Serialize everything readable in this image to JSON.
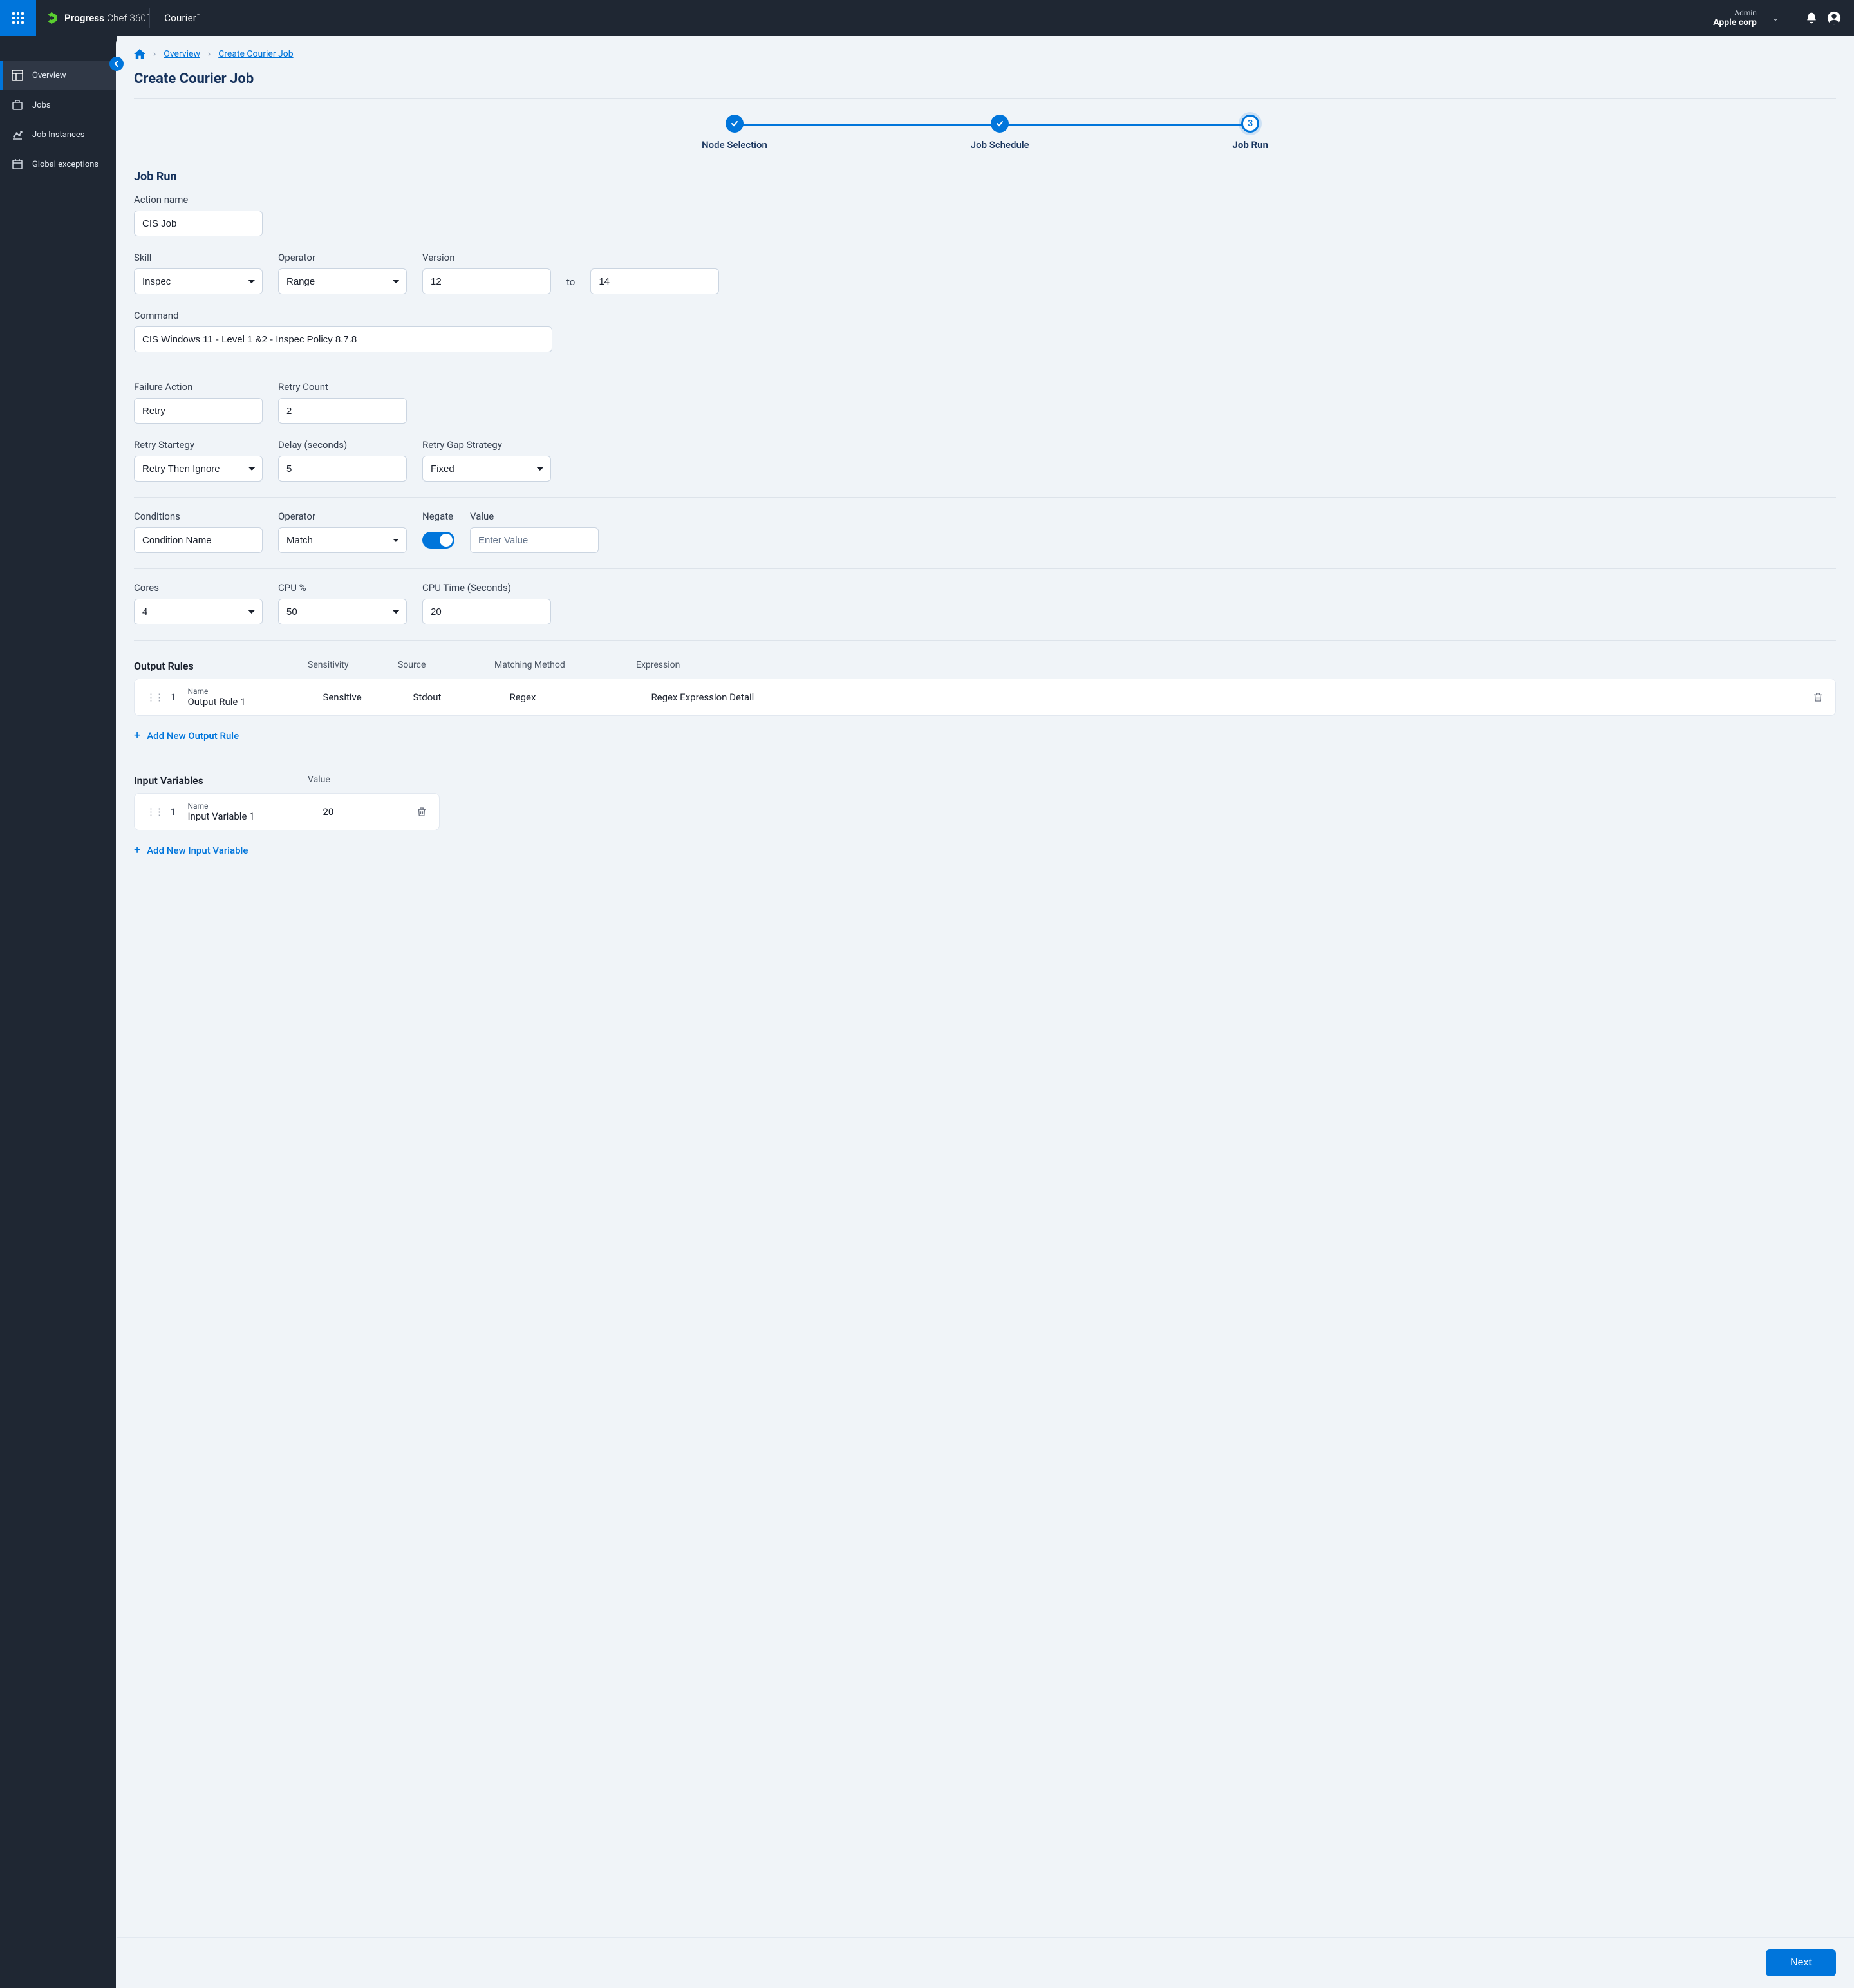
{
  "header": {
    "brand_progress": "Progress",
    "brand_chef": "Chef 360",
    "brand_tm": "™",
    "product": "Courier",
    "role": "Admin",
    "org": "Apple corp"
  },
  "sidebar": {
    "items": [
      {
        "label": "Overview",
        "icon": "dashboard-icon",
        "active": true
      },
      {
        "label": "Jobs",
        "icon": "briefcase-icon",
        "active": false
      },
      {
        "label": "Job Instances",
        "icon": "chart-icon",
        "active": false
      },
      {
        "label": "Global exceptions",
        "icon": "calendar-icon",
        "active": false
      }
    ]
  },
  "breadcrumb": {
    "overview": "Overview",
    "create": "Create Courier Job"
  },
  "page": {
    "title": "Create Courier Job"
  },
  "stepper": {
    "steps": [
      {
        "label": "Node Selection",
        "state": "done"
      },
      {
        "label": "Job Schedule",
        "state": "done"
      },
      {
        "label": "Job Run",
        "state": "current",
        "num": "3"
      }
    ]
  },
  "section": {
    "title": "Job Run",
    "action_name_label": "Action name",
    "action_name_value": "CIS Job",
    "skill_label": "Skill",
    "skill_value": "Inspec",
    "operator_label": "Operator",
    "operator_value": "Range",
    "version_label": "Version",
    "version_from": "12",
    "version_to_label": "to",
    "version_to": "14",
    "command_label": "Command",
    "command_value": "CIS Windows 11 - Level 1 &2 - Inspec Policy 8.7.8",
    "failure_action_label": "Failure Action",
    "failure_action_value": "Retry",
    "retry_count_label": "Retry Count",
    "retry_count_value": "2",
    "retry_strategy_label": "Retry Startegy",
    "retry_strategy_value": "Retry Then Ignore",
    "delay_label": "Delay (seconds)",
    "delay_value": "5",
    "retry_gap_label": "Retry Gap Strategy",
    "retry_gap_value": "Fixed",
    "conditions_label": "Conditions",
    "conditions_value": "Condition Name",
    "cond_operator_label": "Operator",
    "cond_operator_value": "Match",
    "negate_label": "Negate",
    "value_label": "Value",
    "value_placeholder": "Enter Value",
    "cores_label": "Cores",
    "cores_value": "4",
    "cpu_pct_label": "CPU %",
    "cpu_pct_value": "50",
    "cpu_time_label": "CPU Time (Seconds)",
    "cpu_time_value": "20"
  },
  "output_rules": {
    "title": "Output Rules",
    "headers": {
      "sensitivity": "Sensitivity",
      "source": "Source",
      "matching": "Matching Method",
      "expression": "Expression"
    },
    "row": {
      "index": "1",
      "name_label": "Name",
      "name": "Output Rule 1",
      "sensitivity": "Sensitive",
      "source": "Stdout",
      "matching": "Regex",
      "expression": "Regex Expression Detail"
    },
    "add": "Add New Output Rule"
  },
  "input_vars": {
    "title": "Input Variables",
    "header_value": "Value",
    "row": {
      "index": "1",
      "name_label": "Name",
      "name": "Input Variable 1",
      "value": "20"
    },
    "add": "Add New Input Variable"
  },
  "footer": {
    "next": "Next"
  }
}
